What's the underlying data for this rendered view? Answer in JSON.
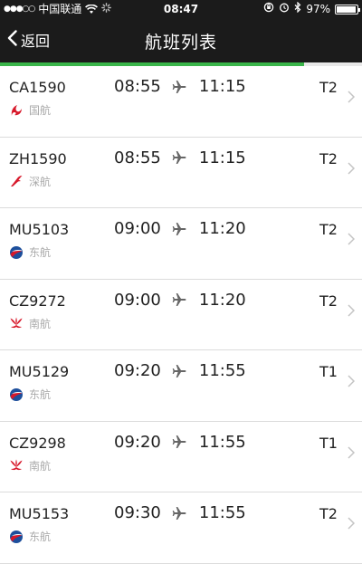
{
  "status_bar": {
    "signal": "●●●○○",
    "carrier": "中国联通",
    "time": "08:47",
    "battery": "97%",
    "battery_level": 0.97
  },
  "nav": {
    "back_label": "返回",
    "title": "航班列表",
    "loading_progress": 0.84
  },
  "flights": [
    {
      "flight_no": "CA1590",
      "airline": "国航",
      "airline_logo": "air-china-logo",
      "depart": "08:55",
      "arrive": "11:15",
      "terminal": "T2"
    },
    {
      "flight_no": "ZH1590",
      "airline": "深航",
      "airline_logo": "shenzhen-airlines-logo",
      "depart": "08:55",
      "arrive": "11:15",
      "terminal": "T2"
    },
    {
      "flight_no": "MU5103",
      "airline": "东航",
      "airline_logo": "china-eastern-logo",
      "depart": "09:00",
      "arrive": "11:20",
      "terminal": "T2"
    },
    {
      "flight_no": "CZ9272",
      "airline": "南航",
      "airline_logo": "china-southern-logo",
      "depart": "09:00",
      "arrive": "11:20",
      "terminal": "T2"
    },
    {
      "flight_no": "MU5129",
      "airline": "东航",
      "airline_logo": "china-eastern-logo",
      "depart": "09:20",
      "arrive": "11:55",
      "terminal": "T1"
    },
    {
      "flight_no": "CZ9298",
      "airline": "南航",
      "airline_logo": "china-southern-logo",
      "depart": "09:20",
      "arrive": "11:55",
      "terminal": "T1"
    },
    {
      "flight_no": "MU5153",
      "airline": "东航",
      "airline_logo": "china-eastern-logo",
      "depart": "09:30",
      "arrive": "11:55",
      "terminal": "T2"
    }
  ],
  "colors": {
    "nav_background": "#1b1b1b",
    "progress": "#3ab54a",
    "air_china": "#d7182a",
    "china_eastern_blue": "#1d4f9c",
    "china_southern": "#d7182a"
  }
}
